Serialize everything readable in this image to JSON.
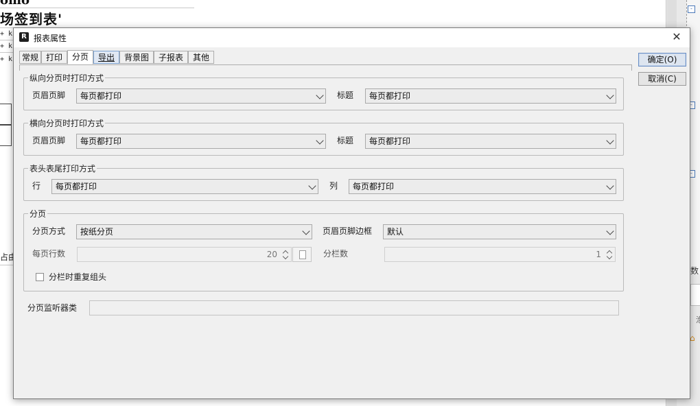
{
  "background": {
    "title_fragment": "omo",
    "title": "场签到表'",
    "rows": [
      "+ k",
      "+ k",
      "+ k"
    ],
    "cut_text": "占由",
    "right_label": "数",
    "right_small": "泡"
  },
  "dialog": {
    "title": "报表属性",
    "icon_letter": "R",
    "close_glyph": "✕",
    "tabs": [
      "常规",
      "打印",
      "分页",
      "导出",
      "背景图",
      "子报表",
      "其他"
    ],
    "selected_tab": "分页",
    "ok_button": "确定(O)",
    "cancel_button": "取消(C)",
    "groups": {
      "vertical": {
        "legend": "纵向分页时打印方式",
        "header_footer_label": "页眉页脚",
        "header_footer_value": "每页都打印",
        "title_label": "标题",
        "title_value": "每页都打印"
      },
      "horizontal": {
        "legend": "横向分页时打印方式",
        "header_footer_label": "页眉页脚",
        "header_footer_value": "每页都打印",
        "title_label": "标题",
        "title_value": "每页都打印"
      },
      "head_tail": {
        "legend": "表头表尾打印方式",
        "row_label": "行",
        "row_value": "每页都打印",
        "col_label": "列",
        "col_value": "每页都打印"
      },
      "paging": {
        "legend": "分页",
        "mode_label": "分页方式",
        "mode_value": "按纸分页",
        "border_label": "页眉页脚边框",
        "border_value": "默认",
        "rows_label": "每页行数",
        "rows_value": "20",
        "columns_label": "分栏数",
        "columns_value": "1",
        "repeat_checkbox_label": "分栏时重复组头",
        "repeat_checked": false
      }
    },
    "listener_label": "分页监听器类",
    "listener_value": ""
  }
}
